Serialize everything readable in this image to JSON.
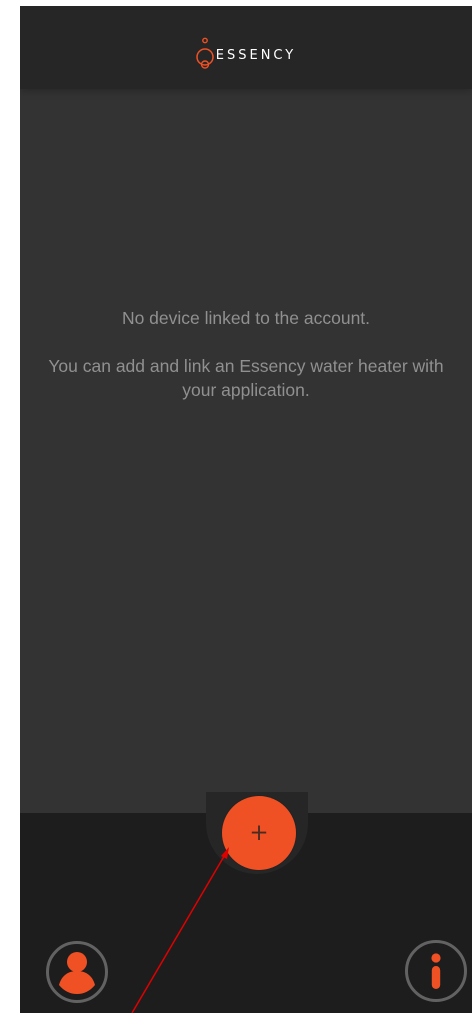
{
  "header": {
    "brand_name": "ESSENCY",
    "logo_icon": "water-drop-logo-icon"
  },
  "main": {
    "empty_title": "No device linked to the account.",
    "empty_message": "You can add and link an Essency water heater with your application."
  },
  "bottom_nav": {
    "add_label": "+",
    "profile_icon": "user-icon",
    "info_icon": "info-icon"
  },
  "colors": {
    "accent": "#ef5124",
    "background": "#333333",
    "header": "#262626",
    "bottom_bar": "#1d1d1d",
    "text_muted": "#909090",
    "annotation_arrow": "#e00000"
  }
}
